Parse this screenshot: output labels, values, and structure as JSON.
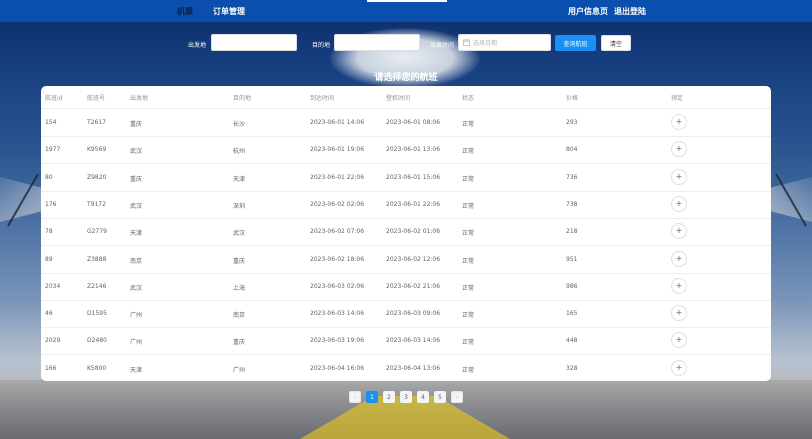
{
  "nav": {
    "home": "机票",
    "orders": "订单管理",
    "user_info": "用户信息页",
    "logout": "退出登陆"
  },
  "search": {
    "from_label": "出发地",
    "from_value": "",
    "to_label": "目的地",
    "to_value": "",
    "date_label": "出发时间",
    "date_placeholder": "选择日期",
    "query_button": "查询航班",
    "clear_button": "清空"
  },
  "page_title": "请选择您的航班",
  "table": {
    "columns": [
      "航班id",
      "航班号",
      "出发地",
      "目的地",
      "到达时间",
      "登机时间",
      "状态",
      "价格",
      "预定"
    ],
    "rows": [
      {
        "id": "154",
        "flight_no": "T2617",
        "from": "重庆",
        "to": "长沙",
        "arrive": "2023-06-01 14:06",
        "board": "2023-06-01 08:06",
        "status": "正常",
        "price": "293"
      },
      {
        "id": "1977",
        "flight_no": "K9569",
        "from": "武汉",
        "to": "杭州",
        "arrive": "2023-06-01 19:06",
        "board": "2023-06-01 13:06",
        "status": "正常",
        "price": "804"
      },
      {
        "id": "80",
        "flight_no": "Z9820",
        "from": "重庆",
        "to": "天津",
        "arrive": "2023-06-01 22:06",
        "board": "2023-06-01 15:06",
        "status": "正常",
        "price": "736"
      },
      {
        "id": "176",
        "flight_no": "T9172",
        "from": "武汉",
        "to": "深圳",
        "arrive": "2023-06-02 02:06",
        "board": "2023-06-01 22:06",
        "status": "正常",
        "price": "738"
      },
      {
        "id": "78",
        "flight_no": "G2779",
        "from": "天津",
        "to": "武汉",
        "arrive": "2023-06-02 07:06",
        "board": "2023-06-02 01:06",
        "status": "正常",
        "price": "218"
      },
      {
        "id": "89",
        "flight_no": "Z3888",
        "from": "南京",
        "to": "重庆",
        "arrive": "2023-06-02 18:06",
        "board": "2023-06-02 12:06",
        "status": "正常",
        "price": "951"
      },
      {
        "id": "2034",
        "flight_no": "Z2146",
        "from": "武汉",
        "to": "上海",
        "arrive": "2023-06-03 02:06",
        "board": "2023-06-02 21:06",
        "status": "正常",
        "price": "986"
      },
      {
        "id": "46",
        "flight_no": "D1595",
        "from": "广州",
        "to": "南京",
        "arrive": "2023-06-03 14:06",
        "board": "2023-06-03 09:06",
        "status": "正常",
        "price": "165"
      },
      {
        "id": "2029",
        "flight_no": "D2480",
        "from": "广州",
        "to": "重庆",
        "arrive": "2023-06-03 19:06",
        "board": "2023-06-03 14:06",
        "status": "正常",
        "price": "448"
      },
      {
        "id": "166",
        "flight_no": "K5800",
        "from": "天津",
        "to": "广州",
        "arrive": "2023-06-04 16:06",
        "board": "2023-06-04 13:06",
        "status": "正常",
        "price": "328"
      }
    ],
    "add_icon": "plus-icon"
  },
  "pagination": {
    "prev_icon": "chevron-left-icon",
    "next_icon": "chevron-right-icon",
    "prev": "‹",
    "next": "›",
    "pages": [
      "1",
      "2",
      "3",
      "4",
      "5"
    ],
    "current": "1"
  },
  "colors": {
    "navbar": "#0a4fae",
    "primary": "#1a90f5"
  }
}
